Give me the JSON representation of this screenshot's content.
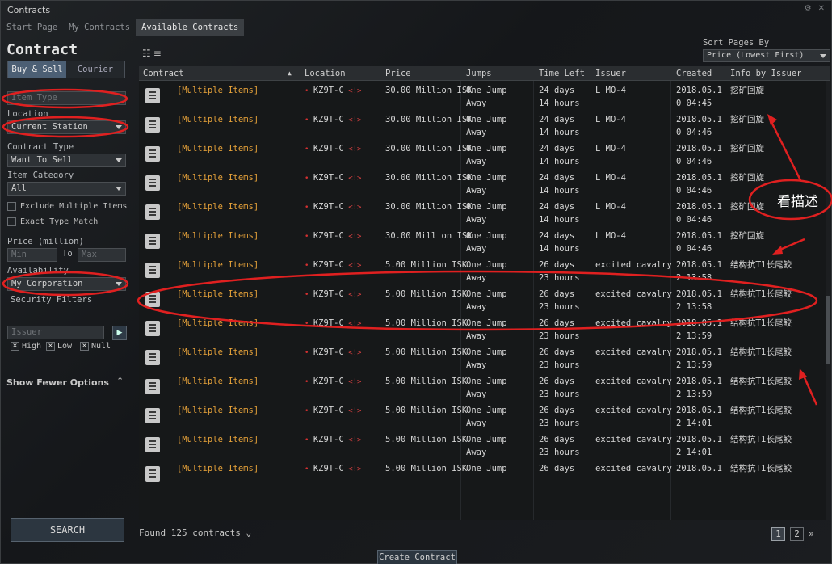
{
  "window": {
    "title": "Contracts"
  },
  "tabs": [
    "Start Page",
    "My Contracts",
    "Available Contracts"
  ],
  "left": {
    "heading": "Contract Search",
    "buy_sell": "Buy & Sell",
    "courier": "Courier",
    "item_type_placeholder": "Item Type",
    "location_label": "Location",
    "location_value": "Current Station",
    "contract_type_label": "Contract Type",
    "contract_type_value": "Want To Sell",
    "item_category_label": "Item Category",
    "item_category_value": "All",
    "exclude_multiple": "Exclude Multiple Items",
    "exact_type": "Exact Type Match",
    "price_label": "Price (million)",
    "min_placeholder": "Min",
    "to_label": "To",
    "max_placeholder": "Max",
    "availability_label": "Availability",
    "availability_value": "My Corporation",
    "security_label": "Security Filters",
    "high": "High",
    "low": "Low",
    "null": "Null",
    "issuer_placeholder": "Issuer",
    "show_fewer": "Show Fewer Options",
    "search": "SEARCH"
  },
  "sort": {
    "label": "Sort Pages By",
    "value": "Price (Lowest First)"
  },
  "columns": [
    "Contract",
    "Location",
    "Price",
    "Jumps",
    "Time Left",
    "Issuer",
    "Created",
    "Info by Issuer"
  ],
  "top_partial": {
    "name": "[Multiple Items]",
    "location": "KZ9T-C",
    "price": "30.00 Million ISK",
    "jumps": "Away",
    "time": "14 hours",
    "issuer": "L MO-4",
    "created": "0 04:45"
  },
  "rows": [
    {
      "name": "[Multiple Items]",
      "location": "KZ9T-C",
      "price": "30.00 Million ISK",
      "jumps1": "One Jump",
      "jumps2": "Away",
      "time1": "24 days",
      "time2": "14 hours",
      "issuer": "L MO-4",
      "created1": "2018.05.1",
      "created2": "0 04:45",
      "info": "挖矿回旋"
    },
    {
      "name": "[Multiple Items]",
      "location": "KZ9T-C",
      "price": "30.00 Million ISK",
      "jumps1": "One Jump",
      "jumps2": "Away",
      "time1": "24 days",
      "time2": "14 hours",
      "issuer": "L MO-4",
      "created1": "2018.05.1",
      "created2": "0 04:46",
      "info": "挖矿回旋"
    },
    {
      "name": "[Multiple Items]",
      "location": "KZ9T-C",
      "price": "30.00 Million ISK",
      "jumps1": "One Jump",
      "jumps2": "Away",
      "time1": "24 days",
      "time2": "14 hours",
      "issuer": "L MO-4",
      "created1": "2018.05.1",
      "created2": "0 04:46",
      "info": "挖矿回旋"
    },
    {
      "name": "[Multiple Items]",
      "location": "KZ9T-C",
      "price": "30.00 Million ISK",
      "jumps1": "One Jump",
      "jumps2": "Away",
      "time1": "24 days",
      "time2": "14 hours",
      "issuer": "L MO-4",
      "created1": "2018.05.1",
      "created2": "0 04:46",
      "info": "挖矿回旋"
    },
    {
      "name": "[Multiple Items]",
      "location": "KZ9T-C",
      "price": "30.00 Million ISK",
      "jumps1": "One Jump",
      "jumps2": "Away",
      "time1": "24 days",
      "time2": "14 hours",
      "issuer": "L MO-4",
      "created1": "2018.05.1",
      "created2": "0 04:46",
      "info": "挖矿回旋"
    },
    {
      "name": "[Multiple Items]",
      "location": "KZ9T-C",
      "price": "30.00 Million ISK",
      "jumps1": "One Jump",
      "jumps2": "Away",
      "time1": "24 days",
      "time2": "14 hours",
      "issuer": "L MO-4",
      "created1": "2018.05.1",
      "created2": "0 04:46",
      "info": "挖矿回旋"
    },
    {
      "name": "[Multiple Items]",
      "location": "KZ9T-C",
      "price": "5.00 Million ISK",
      "jumps1": "One Jump",
      "jumps2": "Away",
      "time1": "26 days",
      "time2": "23 hours",
      "issuer": "excited cavalry",
      "created1": "2018.05.1",
      "created2": "2 13:58",
      "info": "结构抗T1长尾鲛"
    },
    {
      "name": "[Multiple Items]",
      "location": "KZ9T-C",
      "price": "5.00 Million ISK",
      "jumps1": "One Jump",
      "jumps2": "Away",
      "time1": "26 days",
      "time2": "23 hours",
      "issuer": "excited cavalry",
      "created1": "2018.05.1",
      "created2": "2 13:58",
      "info": "结构抗T1长尾鲛"
    },
    {
      "name": "[Multiple Items]",
      "location": "KZ9T-C",
      "price": "5.00 Million ISK",
      "jumps1": "One Jump",
      "jumps2": "Away",
      "time1": "26 days",
      "time2": "23 hours",
      "issuer": "excited cavalry",
      "created1": "2018.05.1",
      "created2": "2 13:59",
      "info": "结构抗T1长尾鲛"
    },
    {
      "name": "[Multiple Items]",
      "location": "KZ9T-C",
      "price": "5.00 Million ISK",
      "jumps1": "One Jump",
      "jumps2": "Away",
      "time1": "26 days",
      "time2": "23 hours",
      "issuer": "excited cavalry",
      "created1": "2018.05.1",
      "created2": "2 13:59",
      "info": "结构抗T1长尾鲛"
    },
    {
      "name": "[Multiple Items]",
      "location": "KZ9T-C",
      "price": "5.00 Million ISK",
      "jumps1": "One Jump",
      "jumps2": "Away",
      "time1": "26 days",
      "time2": "23 hours",
      "issuer": "excited cavalry",
      "created1": "2018.05.1",
      "created2": "2 13:59",
      "info": "结构抗T1长尾鲛"
    },
    {
      "name": "[Multiple Items]",
      "location": "KZ9T-C",
      "price": "5.00 Million ISK",
      "jumps1": "One Jump",
      "jumps2": "Away",
      "time1": "26 days",
      "time2": "23 hours",
      "issuer": "excited cavalry",
      "created1": "2018.05.1",
      "created2": "2 14:01",
      "info": "结构抗T1长尾鲛"
    },
    {
      "name": "[Multiple Items]",
      "location": "KZ9T-C",
      "price": "5.00 Million ISK",
      "jumps1": "One Jump",
      "jumps2": "Away",
      "time1": "26 days",
      "time2": "23 hours",
      "issuer": "excited cavalry",
      "created1": "2018.05.1",
      "created2": "2 14:01",
      "info": "结构抗T1长尾鲛"
    },
    {
      "name": "[Multiple Items]",
      "location": "KZ9T-C",
      "price": "5.00 Million ISK",
      "jumps1": "One Jump",
      "jumps2": "",
      "time1": "26 days",
      "time2": "",
      "issuer": "excited cavalry",
      "created1": "2018.05.1",
      "created2": "",
      "info": "结构抗T1长尾鲛"
    }
  ],
  "footer": {
    "found": "Found 125 contracts",
    "pages": [
      "1",
      "2"
    ],
    "next": "»",
    "create": "Create Contract"
  },
  "annotation": {
    "note": "看描述",
    "color": "#e02020"
  },
  "colors": {
    "accent_orange": "#e8a33a",
    "annotation_red": "#e02020",
    "security_red": "#d23030"
  }
}
